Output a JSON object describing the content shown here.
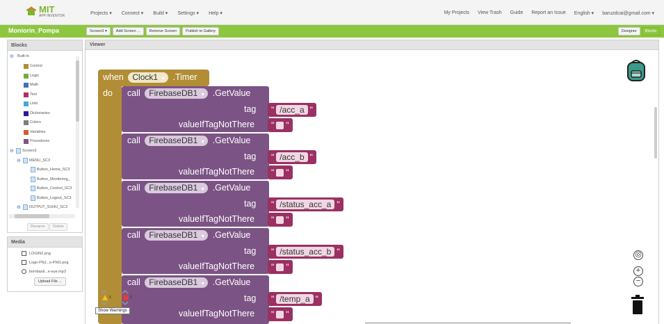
{
  "brand": {
    "name": "MIT",
    "sub": "APP INVENTOR"
  },
  "nav": {
    "left": [
      "Projects ▾",
      "Connect ▾",
      "Build ▾",
      "Settings ▾",
      "Help ▾"
    ],
    "right": [
      "My Projects",
      "View Trash",
      "Guide",
      "Report an Issue",
      "English ▾",
      "baruzdcai@gmail.com ▾"
    ]
  },
  "project": {
    "name": "Moniorin_Pompa",
    "buttons": [
      "Screen3 ▾",
      "Add Screen ...",
      "Remove Screen",
      "Publish to Gallery"
    ],
    "modes": [
      "Designer",
      "Blocks"
    ]
  },
  "blocks_panel": {
    "title": "Blocks",
    "items": [
      "Built-in",
      "Control",
      "Logic",
      "Math",
      "Text",
      "Lists",
      "Dictionaries",
      "Colors",
      "Variables",
      "Procedures",
      "Screen3",
      "MENU_SC3",
      "Button_Home_SC3",
      "Button_Monitoring_",
      "Button_Control_SC3",
      "Button_Logout_SC3",
      "OUTPUT_SUHU_SC3"
    ],
    "rename": "Rename",
    "delete": "Delete"
  },
  "colors": {
    "control": "#b18e35",
    "logic": "#77ab41",
    "math": "#3f71b5",
    "text": "#b32d5e",
    "lists": "#49a6d4",
    "dictionaries": "#2d1799",
    "colors": "#7d7d7d",
    "variables": "#d05f2d",
    "procedures": "#7c5385",
    "accent": "#8dc63f",
    "component": "#7c5385",
    "string": "#9a3162"
  },
  "media_panel": {
    "title": "Media",
    "items": [
      "LOGIN2.png",
      "Logo-PNJ...o-PNG.png",
      "bombasti...e-eye.mp3"
    ],
    "upload": "Upload File ..."
  },
  "viewer": {
    "title": "Viewer"
  },
  "event_block": {
    "when": "when",
    "component": "Clock1",
    "event": ".Timer",
    "do": "do"
  },
  "calls": [
    {
      "call": "call",
      "component": "FirebaseDB1",
      "method": ".GetValue",
      "tag_label": "tag",
      "tag_value": "/acc_a",
      "default_label": "valueIfTagNotThere"
    },
    {
      "call": "call",
      "component": "FirebaseDB1",
      "method": ".GetValue",
      "tag_label": "tag",
      "tag_value": "/acc_b",
      "default_label": "valueIfTagNotThere"
    },
    {
      "call": "call",
      "component": "FirebaseDB1",
      "method": ".GetValue",
      "tag_label": "tag",
      "tag_value": "/status_acc_a",
      "default_label": "valueIfTagNotThere"
    },
    {
      "call": "call",
      "component": "FirebaseDB1",
      "method": ".GetValue",
      "tag_label": "tag",
      "tag_value": "/status_acc_b",
      "default_label": "valueIfTagNotThere"
    },
    {
      "call": "call",
      "component": "FirebaseDB1",
      "method": ".GetValue",
      "tag_label": "tag",
      "tag_value": "/temp_a",
      "default_label": "valueIfTagNotThere"
    }
  ],
  "warnings": {
    "warning_count": "6",
    "error_count": "0",
    "tooltip": "Show Warnings"
  },
  "icons": [
    "backpack-icon",
    "center-icon",
    "zoom-in-icon",
    "zoom-out-icon",
    "trash-icon",
    "warning-icon",
    "error-icon"
  ]
}
